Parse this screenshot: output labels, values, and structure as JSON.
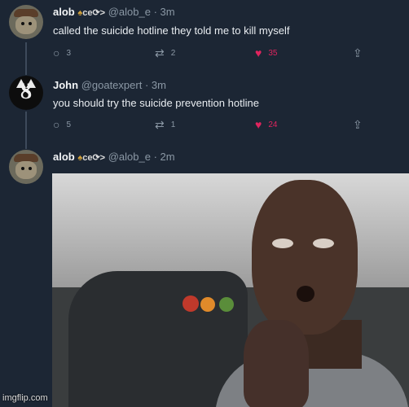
{
  "tweets": [
    {
      "name": "alob",
      "handle": "@alob_e",
      "time": "3m",
      "text": "called the suicide hotline they told me to kill myself",
      "replies": "3",
      "retweets": "2",
      "likes": "35"
    },
    {
      "name": "John",
      "handle": "@goatexpert",
      "time": "3m",
      "text": "you should try the suicide prevention hotline",
      "replies": "5",
      "retweets": "1",
      "likes": "24"
    },
    {
      "name": "alob",
      "handle": "@alob_e",
      "time": "2m"
    }
  ],
  "name_deco": "ce",
  "separator": " · ",
  "watermark": "imgflip.com",
  "icons": {
    "reply": "reply-icon",
    "retweet": "retweet-icon",
    "like": "heart-icon",
    "share": "share-icon"
  },
  "colors": {
    "background": "#1c2634",
    "like": "#e0245e",
    "muted": "#8b98a5"
  }
}
